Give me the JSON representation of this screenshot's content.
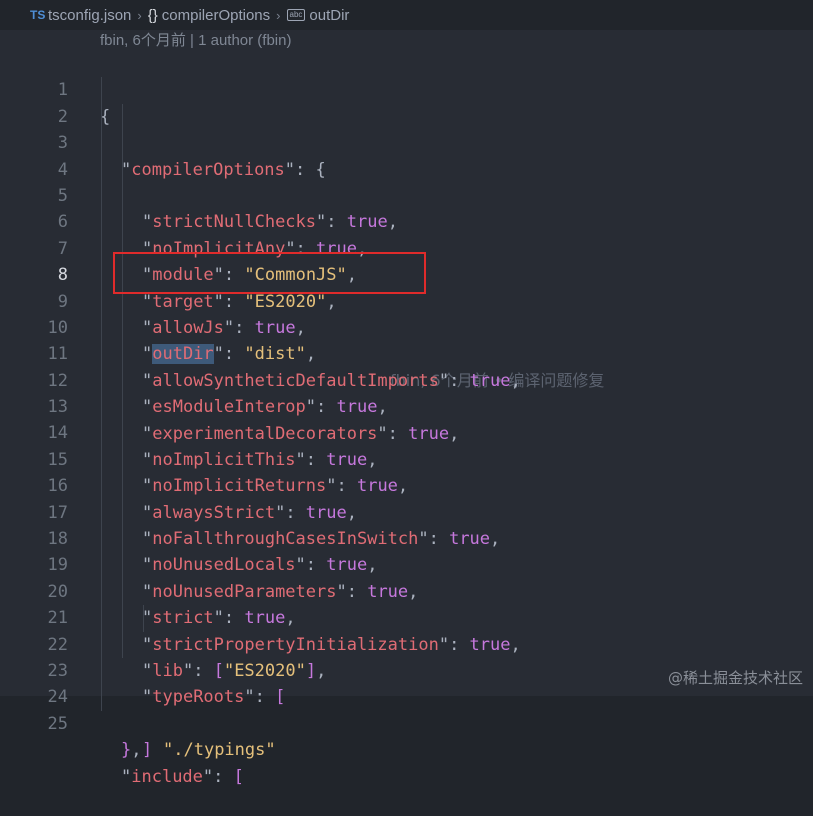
{
  "breadcrumb": {
    "file_icon": "TS",
    "file": "tsconfig.json",
    "separator": "›",
    "section_icon": "{}",
    "section": "compilerOptions",
    "property_icon": "abc",
    "property": "outDir"
  },
  "codelens": "fbin, 6个月前 | 1 author (fbin)",
  "line_numbers": [
    "1",
    "2",
    "3",
    "4",
    "5",
    "6",
    "7",
    "8",
    "9",
    "10",
    "11",
    "12",
    "13",
    "14",
    "15",
    "16",
    "17",
    "18",
    "19",
    "20",
    "21",
    "22",
    "23",
    "24",
    "25"
  ],
  "active_line": "8",
  "tokens": {
    "open_brace": "{",
    "compilerOptions_key": "compilerOptions",
    "colon_brace": ": {",
    "strictNullChecks": "strictNullChecks",
    "noImplicitAny": "noImplicitAny",
    "module": "module",
    "module_val": "CommonJS",
    "target": "target",
    "target_val": "ES2020",
    "allowJs": "allowJs",
    "outDir": "outDir",
    "outDir_val": "dist",
    "allowSyntheticDefaultImports": "allowSyntheticDefaultImports",
    "esModuleInterop": "esModuleInterop",
    "experimentalDecorators": "experimentalDecorators",
    "noImplicitThis": "noImplicitThis",
    "noImplicitReturns": "noImplicitReturns",
    "alwaysStrict": "alwaysStrict",
    "noFallthroughCasesInSwitch": "noFallthroughCasesInSwitch",
    "noUnusedLocals": "noUnusedLocals",
    "noUnusedParameters": "noUnusedParameters",
    "strict": "strict",
    "strictPropertyInitialization": "strictPropertyInitialization",
    "lib": "lib",
    "lib_val": "ES2020",
    "typeRoots": "typeRoots",
    "typings": "./typings",
    "true": "true",
    "include": "include"
  },
  "blame": "fbin, 6个月前 • 编译问题修复",
  "watermark": "@稀土掘金技术社区",
  "colors": {
    "key": "#e06c75",
    "string": "#98c379",
    "boolean": "#c678dd",
    "highlight_box": "#e02b2b"
  }
}
